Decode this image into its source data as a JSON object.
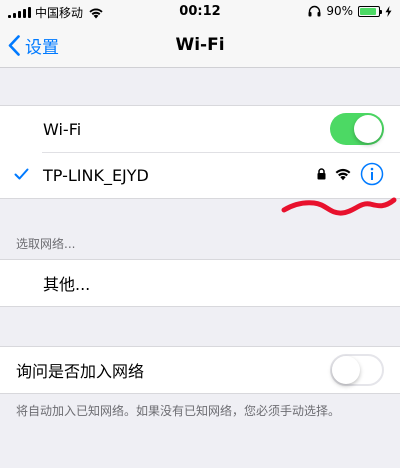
{
  "status_bar": {
    "carrier": "中国移动",
    "time": "00:12",
    "battery_percent": "90%",
    "battery_level": 0.9
  },
  "nav": {
    "back_label": "设置",
    "title": "Wi-Fi"
  },
  "wifi_group": {
    "toggle_label": "Wi-Fi",
    "toggle_on": true,
    "connected_network": "TP-LINK_EJYD"
  },
  "choose_section": {
    "header": "选取网络...",
    "other_label": "其他..."
  },
  "ask_group": {
    "label": "询问是否加入网络",
    "toggle_on": false,
    "footer": "将自动加入已知网络。如果没有已知网络，您必须手动选择。"
  },
  "colors": {
    "accent": "#007aff",
    "switch_on": "#4cd964",
    "scribble": "#e8112d"
  }
}
